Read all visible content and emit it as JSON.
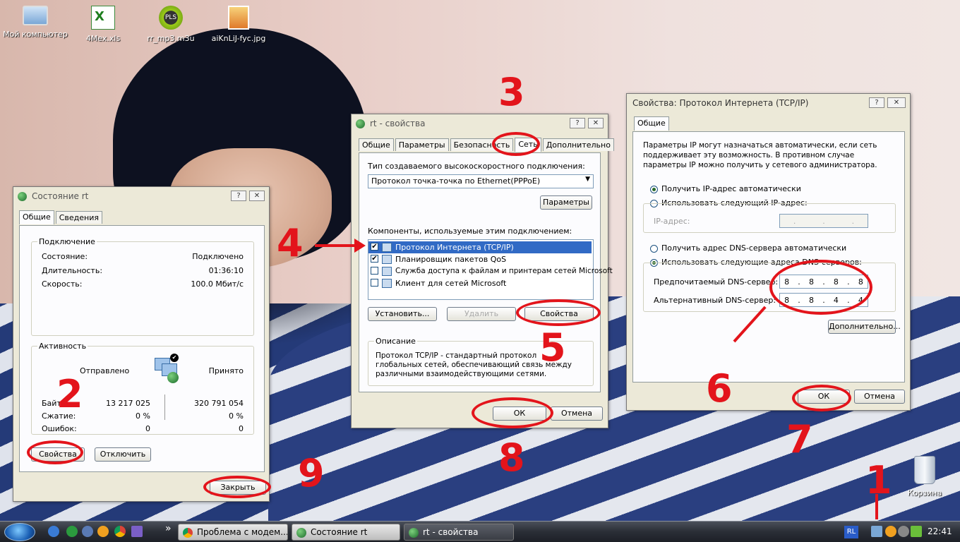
{
  "desktop_icons": [
    {
      "label": "Мой компьютер"
    },
    {
      "label": "4Mex.xls"
    },
    {
      "label": "rr_mp3.m3u",
      "badge": "PLS"
    },
    {
      "label": "aiKnLiJ-fyc.jpg"
    },
    {
      "label": "Корзина"
    }
  ],
  "status_window": {
    "title": "Состояние rt",
    "tabs": [
      "Общие",
      "Сведения"
    ],
    "connection_group": "Подключение",
    "rows": [
      {
        "label": "Состояние:",
        "value": "Подключено"
      },
      {
        "label": "Длительность:",
        "value": "01:36:10"
      },
      {
        "label": "Скорость:",
        "value": "100.0 Мбит/с"
      }
    ],
    "activity_group": "Активность",
    "sent": "Отправлено",
    "received": "Принято",
    "stats": [
      {
        "label": "Байт:",
        "sent": "13 217 025",
        "received": "320 791 054"
      },
      {
        "label": "Сжатие:",
        "sent": "0 %",
        "received": "0 %"
      },
      {
        "label": "Ошибок:",
        "sent": "0",
        "received": "0"
      }
    ],
    "btn_properties": "Свойства",
    "btn_disconnect": "Отключить",
    "btn_close": "Закрыть"
  },
  "props_window": {
    "title": "rt - свойства",
    "tabs": [
      "Общие",
      "Параметры",
      "Безопасность",
      "Сеть",
      "Дополнительно"
    ],
    "conn_type_label": "Тип создаваемого высокоскоростного подключения:",
    "conn_type_value": "Протокол точка-точка по Ethernet(PPPoE)",
    "btn_params": "Параметры",
    "components_label": "Компоненты, используемые этим подключением:",
    "components": [
      {
        "label": "Протокол Интернета (TCP/IP)",
        "checked": "✔"
      },
      {
        "label": "Планировщик пакетов QoS",
        "checked": "✔"
      },
      {
        "label": "Служба доступа к файлам и принтерам сетей Microsoft",
        "checked": ""
      },
      {
        "label": "Клиент для сетей Microsoft",
        "checked": ""
      }
    ],
    "btn_install": "Установить...",
    "btn_remove": "Удалить",
    "btn_props": "Свойства",
    "desc_group": "Описание",
    "desc_text": "Протокол TCP/IP - стандартный протокол глобальных сетей, обеспечивающий связь между различными взаимодействующими сетями.",
    "btn_ok": "ОК",
    "btn_cancel": "Отмена"
  },
  "tcp_window": {
    "title": "Свойства: Протокол Интернета (TCP/IP)",
    "tab": "Общие",
    "info": "Параметры IP могут назначаться автоматически, если сеть поддерживает эту возможность. В противном случае параметры IP можно получить у сетевого администратора.",
    "radio_ip_auto": "Получить IP-адрес автоматически",
    "radio_ip_manual": "Использовать следующий IP-адрес:",
    "ip_label": "IP-адрес:",
    "radio_dns_auto": "Получить адрес DNS-сервера автоматически",
    "radio_dns_manual": "Использовать следующие адреса DNS-серверов:",
    "dns_pref_label": "Предпочитаемый DNS-сервер:",
    "dns_pref": [
      "8",
      "8",
      "8",
      "8"
    ],
    "dns_alt_label": "Альтернативный DNS-сервер:",
    "dns_alt": [
      "8",
      "8",
      "4",
      "4"
    ],
    "btn_advanced": "Дополнительно...",
    "btn_ok": "ОК",
    "btn_cancel": "Отмена"
  },
  "annotations": [
    "1",
    "2",
    "3",
    "4",
    "5",
    "6",
    "7",
    "8",
    "9"
  ],
  "taskbar": {
    "tasks": [
      "Проблема с модем...",
      "Состояние rt",
      "rt - свойства"
    ],
    "lang": "RL",
    "clock": "22:41",
    "more": "»"
  },
  "colors": {
    "annotation": "#e3141b",
    "accent": "#316ac5"
  }
}
